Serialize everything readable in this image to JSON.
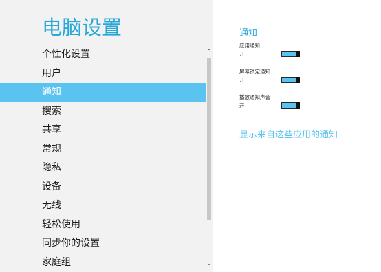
{
  "sidebar": {
    "title": "电脑设置",
    "items": [
      {
        "label": "个性化设置"
      },
      {
        "label": "用户"
      },
      {
        "label": "通知"
      },
      {
        "label": "搜索"
      },
      {
        "label": "共享"
      },
      {
        "label": "常规"
      },
      {
        "label": "隐私"
      },
      {
        "label": "设备"
      },
      {
        "label": "无线"
      },
      {
        "label": "轻松使用"
      },
      {
        "label": "同步你的设置"
      },
      {
        "label": "家庭组"
      }
    ],
    "selected": "通知",
    "scroll_up_glyph": "⌃",
    "scroll_down_glyph": "⌄"
  },
  "main": {
    "section_title": "通知",
    "settings": [
      {
        "label": "应用通知",
        "state": "开",
        "on": true
      },
      {
        "label": "屏幕锁定通知",
        "state": "开",
        "on": true
      },
      {
        "label": "播放通知声音",
        "state": "开",
        "on": true
      }
    ],
    "link_text": "显示来自这些应用的通知"
  },
  "colors": {
    "accent": "#29a8d8",
    "selection": "#5bc3f0",
    "sidebar_bg": "#f2f2f2"
  }
}
